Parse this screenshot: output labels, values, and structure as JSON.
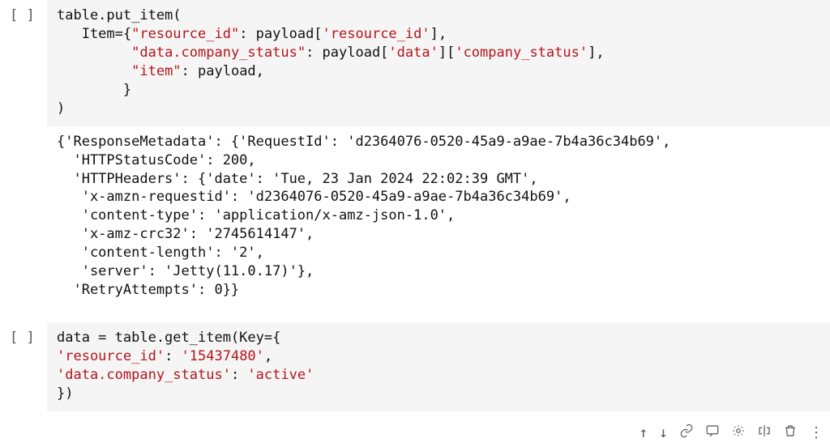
{
  "cells": {
    "c1": {
      "prompt": "[ ]",
      "code": {
        "l1a": "table.put_item(",
        "l2a": "   Item={",
        "l2b": "\"resource_id\"",
        "l2c": ": payload[",
        "l2d": "'resource_id'",
        "l2e": "],",
        "l3b": "\"data.company_status\"",
        "l3c": ": payload[",
        "l3d": "'data'",
        "l3e": "][",
        "l3f": "'company_status'",
        "l3g": "],",
        "l4b": "\"item\"",
        "l4c": ": payload,",
        "l5a": "        }",
        "l6a": ")"
      },
      "output": "{'ResponseMetadata': {'RequestId': 'd2364076-0520-45a9-a9ae-7b4a36c34b69',\n  'HTTPStatusCode': 200,\n  'HTTPHeaders': {'date': 'Tue, 23 Jan 2024 22:02:39 GMT',\n   'x-amzn-requestid': 'd2364076-0520-45a9-a9ae-7b4a36c34b69',\n   'content-type': 'application/x-amz-json-1.0',\n   'x-amz-crc32': '2745614147',\n   'content-length': '2',\n   'server': 'Jetty(11.0.17)'},\n  'RetryAttempts': 0}}"
    },
    "c2": {
      "prompt": "[ ]",
      "code": {
        "l1a": "data = table.get_item(Key={",
        "l2a": "'resource_id'",
        "l2b": ": ",
        "l2c": "'15437480'",
        "l2d": ",",
        "l3a": "'data.company_status'",
        "l3b": ": ",
        "l3c": "'active'",
        "l4a": "})"
      }
    }
  },
  "toolbar": {
    "up": "↑",
    "down": "↓",
    "more": "⋮"
  }
}
